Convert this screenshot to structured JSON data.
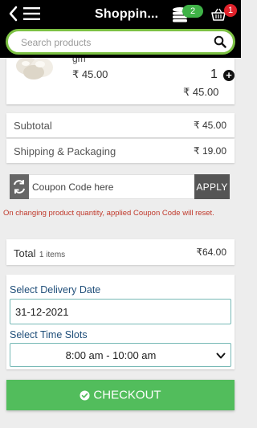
{
  "header": {
    "title": "Shoppin...",
    "coin_count": "2",
    "cart_count": "1",
    "search_placeholder": "Search products",
    "icons": [
      "back-arrow-icon",
      "menu-icon",
      "coins-icon",
      "cart-icon",
      "search-icon"
    ]
  },
  "product": {
    "name_fragment": "gm",
    "price": "₹ 45.00",
    "quantity": "1",
    "total": "₹ 45.00"
  },
  "summary": {
    "subtotal_label": "Subtotal",
    "subtotal_value": "₹ 45.00",
    "shipping_label": "Shipping & Packaging",
    "shipping_value": "₹ 19.00"
  },
  "coupon": {
    "placeholder": "Coupon Code here",
    "apply_label": "APPLY",
    "warning": "On changing product quantity, applied Coupon Code will reset."
  },
  "total": {
    "label": "Total",
    "items": "1 items",
    "value": "₹64.00"
  },
  "delivery": {
    "date_label": "Select Delivery Date",
    "date_value": "31-12-2021",
    "slot_label": "Select Time Slots",
    "slot_value": "8:00 am  -  10:00 am"
  },
  "checkout_label": "CHECKOUT",
  "colors": {
    "accent_green": "#52bd5c",
    "search_border": "#7cc143",
    "badge_red": "#e0222b",
    "label_blue": "#1f4e79",
    "warning_red": "#c0392b"
  }
}
